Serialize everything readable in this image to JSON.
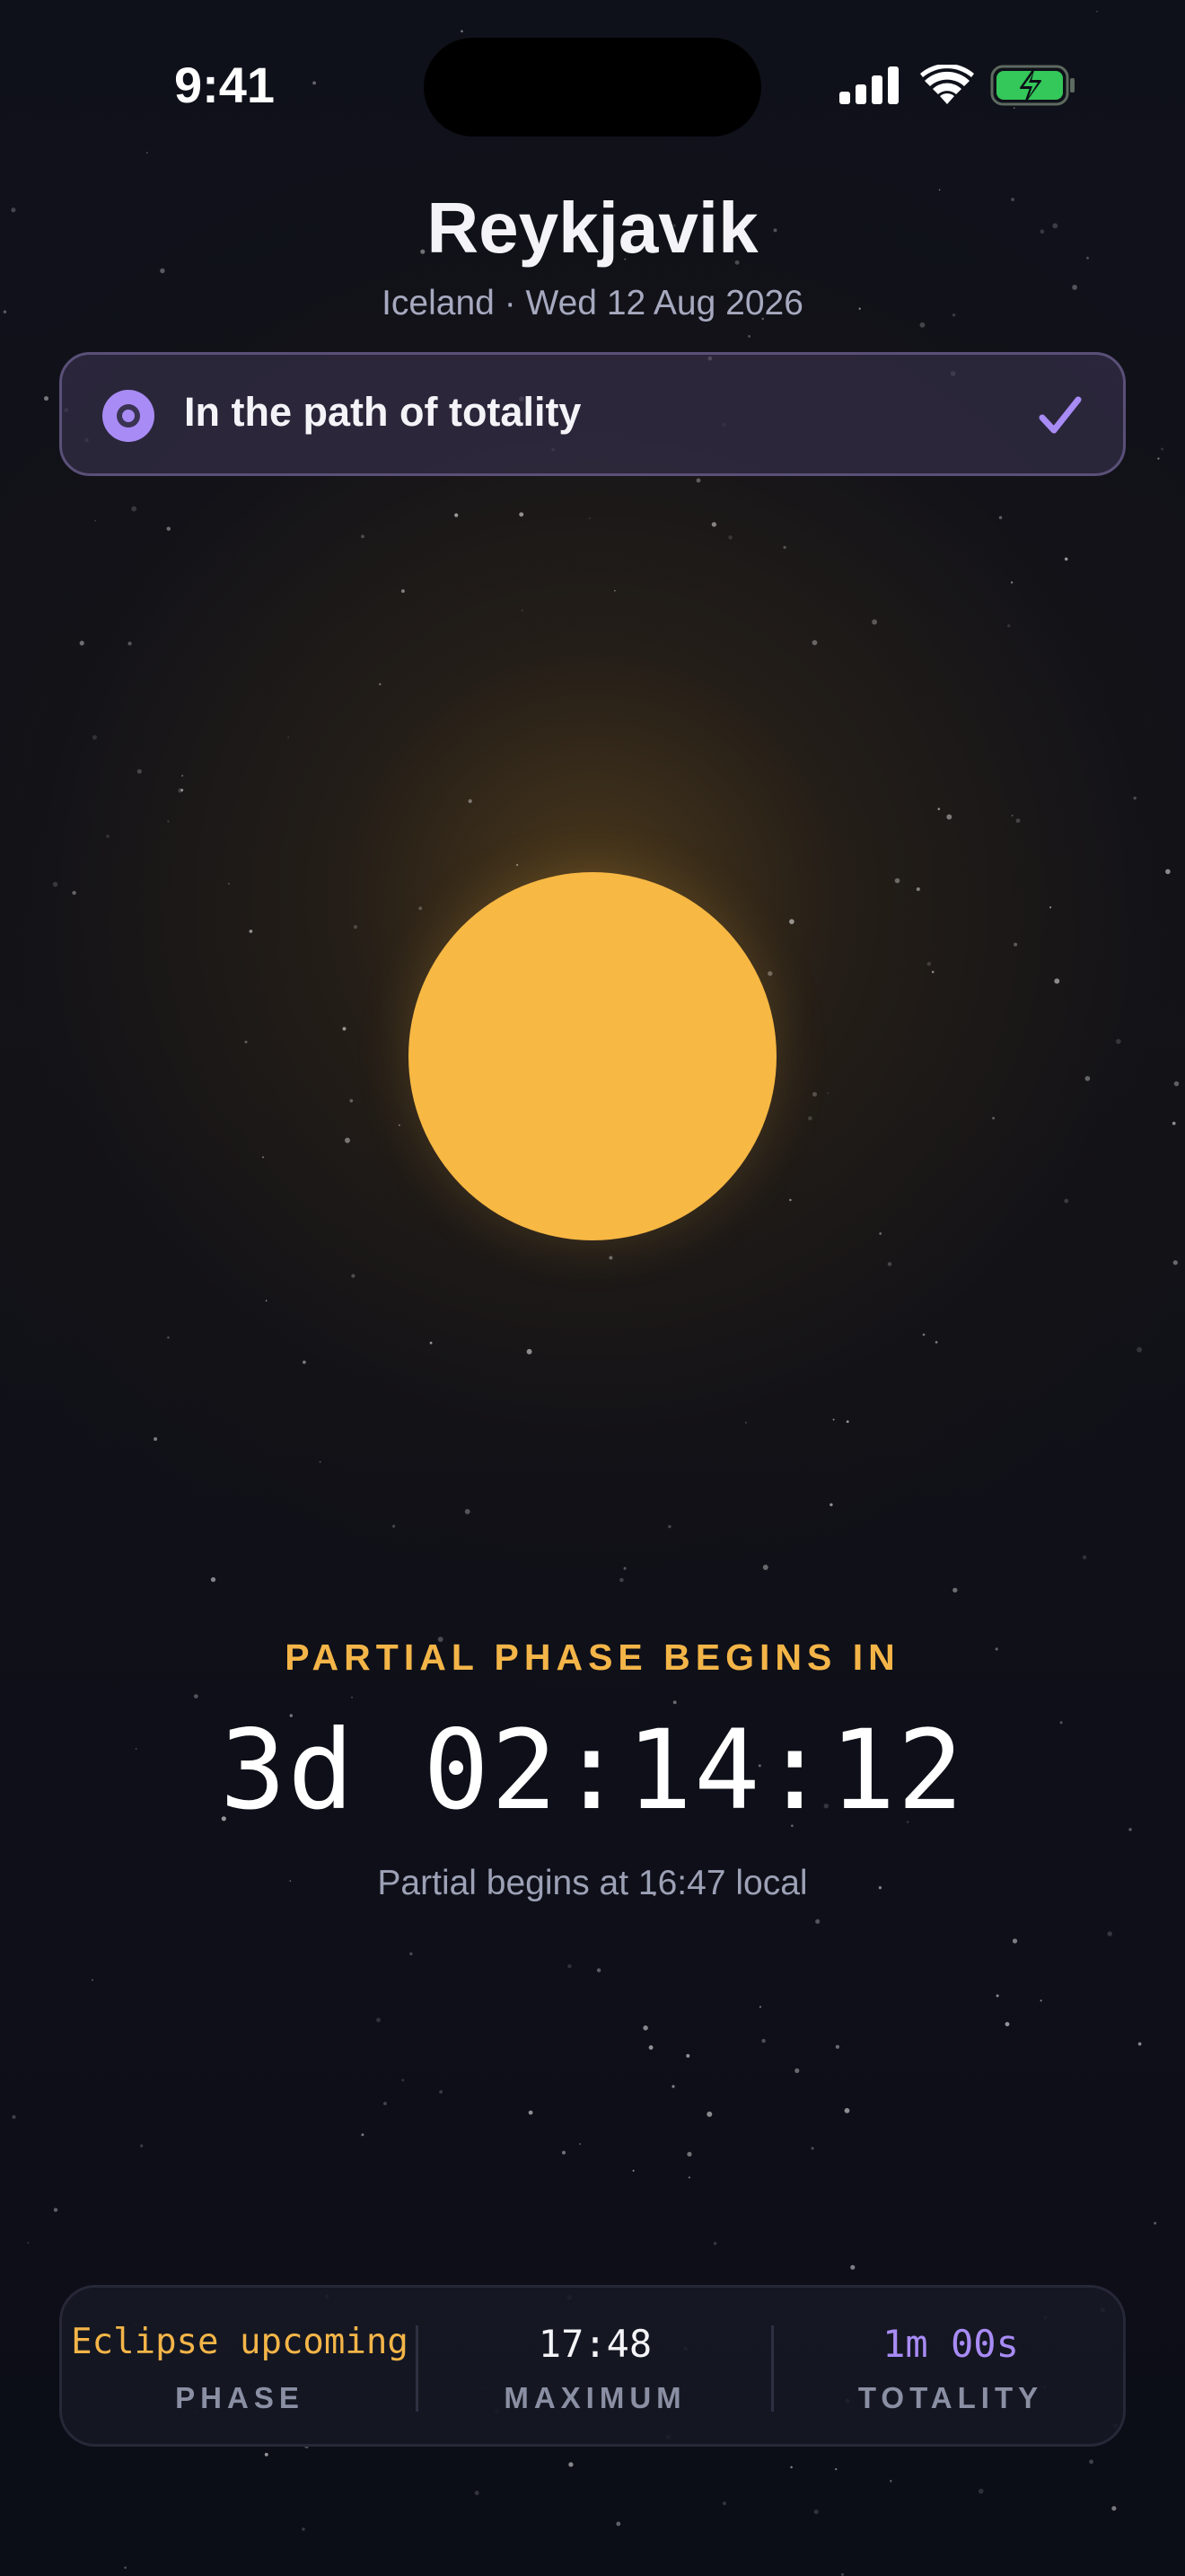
{
  "status_bar": {
    "time": "9:41"
  },
  "header": {
    "city": "Reykjavik",
    "subtitle": "Iceland · Wed 12 Aug 2026"
  },
  "path_banner": {
    "text": "In the path of totality",
    "icon": "target-icon",
    "status_icon": "checkmark-icon"
  },
  "countdown": {
    "label": "PARTIAL PHASE BEGINS IN",
    "value": "3d 02:14:12",
    "note": "Partial begins at 16:47 local"
  },
  "stats": [
    {
      "value": "Eclipse upcoming",
      "label": "PHASE"
    },
    {
      "value": "17:48",
      "label": "MAXIMUM"
    },
    {
      "value": "1m 00s",
      "label": "TOTALITY"
    }
  ],
  "colors": {
    "accent_gold": "#f4b548",
    "accent_purple": "#a88bf5",
    "sun": "#f7b844",
    "background": "#0c0e17",
    "battery_green": "#34c759"
  }
}
